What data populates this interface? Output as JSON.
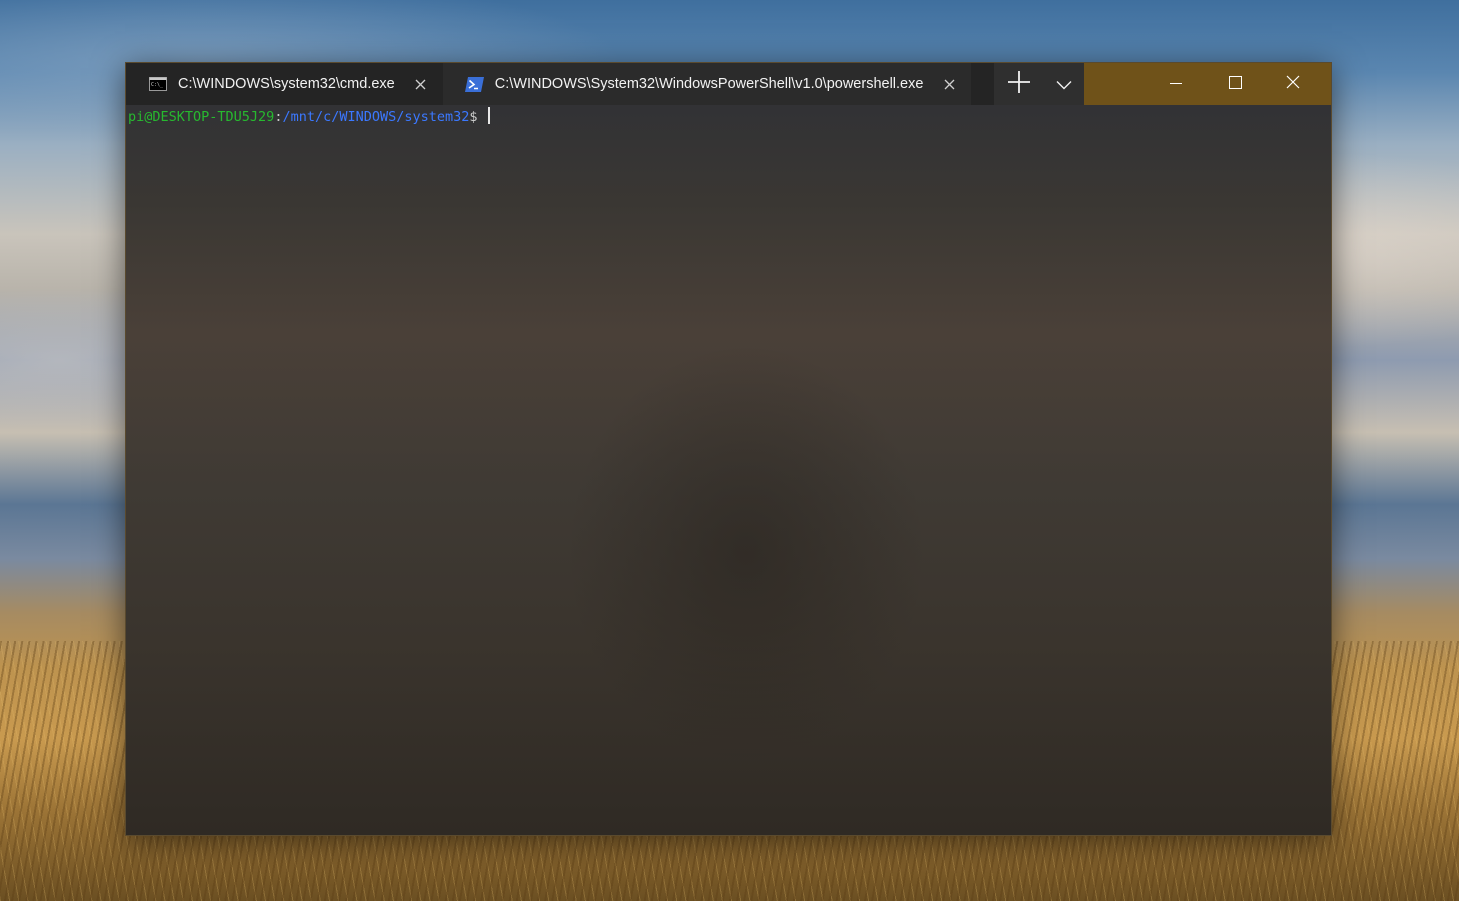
{
  "tabs": [
    {
      "title": "C:\\WINDOWS\\system32\\cmd.exe",
      "icon": "cmd-icon"
    },
    {
      "title": "C:\\WINDOWS\\System32\\WindowsPowerShell\\v1.0\\powershell.exe",
      "icon": "powershell-icon"
    },
    {
      "title": "",
      "icon": "linux-tux-icon"
    }
  ],
  "terminal": {
    "prompt_user_host": "pi@DESKTOP-TDU5J29",
    "prompt_colon": ":",
    "prompt_path": "/mnt/c/WINDOWS/system32",
    "prompt_symbol": "$ "
  },
  "colors": {
    "titlebar": "#6f5219",
    "prompt_user": "#27b92f",
    "prompt_path": "#3b78ff"
  }
}
